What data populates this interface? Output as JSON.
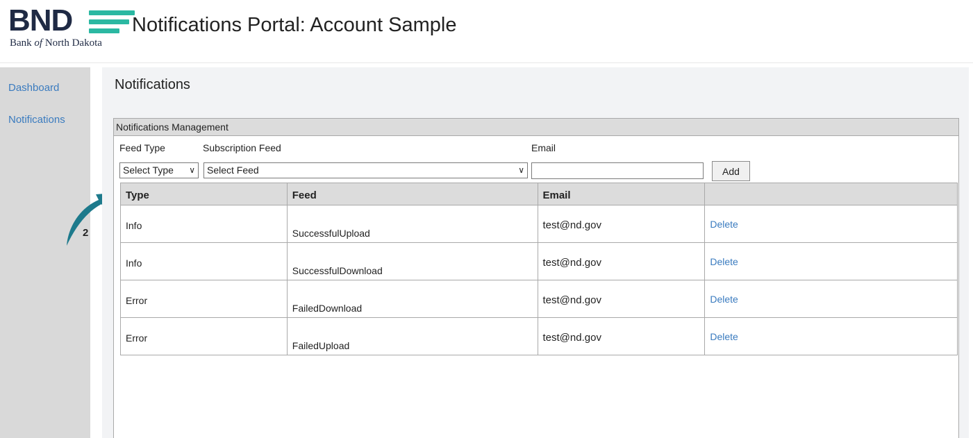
{
  "header": {
    "logo_letters": "BND",
    "logo_sub_prefix": "Bank ",
    "logo_sub_italic": "of",
    "logo_sub_suffix": " North Dakota",
    "portal_title": "Notifications Portal: Account Sample"
  },
  "sidebar": {
    "items": [
      {
        "label": "Dashboard"
      },
      {
        "label": "Notifications"
      }
    ]
  },
  "main": {
    "heading": "Notifications",
    "panel_title": "Notifications Management",
    "form": {
      "feed_type_label": "Feed Type",
      "subscription_feed_label": "Subscription Feed",
      "email_label": "Email",
      "feed_type_selected": "Select Type",
      "subscription_feed_selected": "Select Feed",
      "email_value": "",
      "add_label": "Add"
    },
    "table": {
      "columns": [
        "Type",
        "Feed",
        "Email",
        ""
      ],
      "rows": [
        {
          "type": "Info",
          "feed": "SuccessfulUpload",
          "email": "test@nd.gov",
          "action": "Delete"
        },
        {
          "type": "Info",
          "feed": "SuccessfulDownload",
          "email": "test@nd.gov",
          "action": "Delete"
        },
        {
          "type": "Error",
          "feed": "FailedDownload",
          "email": "test@nd.gov",
          "action": "Delete"
        },
        {
          "type": "Error",
          "feed": "FailedUpload",
          "email": "test@nd.gov",
          "action": "Delete"
        }
      ]
    }
  },
  "annotation": {
    "number": "2",
    "color": "#1d7a8c"
  },
  "colors": {
    "brand_navy": "#1f2a44",
    "brand_teal": "#2bb8a2",
    "link_blue": "#3a7bbf",
    "sidebar_gray": "#d9d9d9",
    "header_gray": "#dcdcdc"
  },
  "icons": {
    "dropdown": "chevron-down-icon",
    "annotation": "curved-arrow-icon"
  }
}
